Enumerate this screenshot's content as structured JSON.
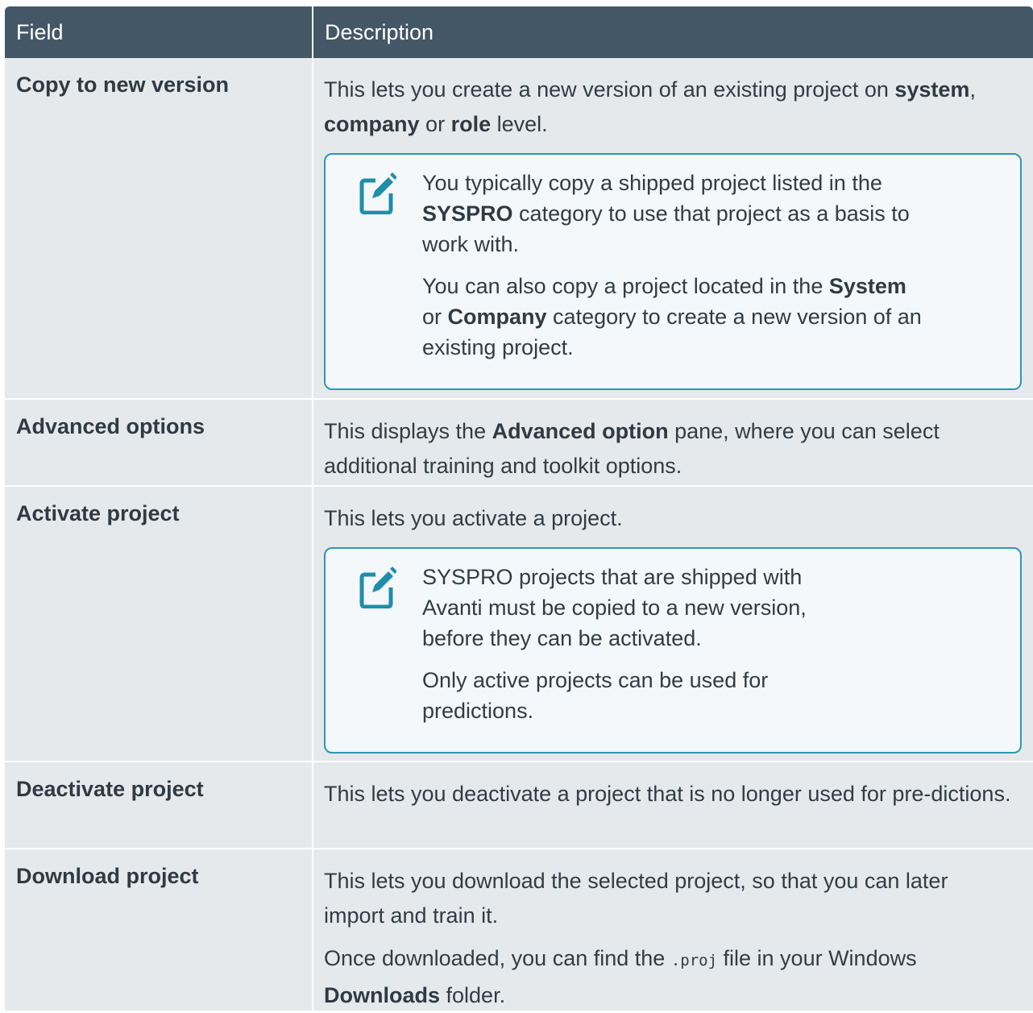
{
  "header": {
    "field": "Field",
    "description": "Description"
  },
  "rows": [
    {
      "field": "Copy to new version",
      "desc_parts": [
        "This lets you create a new version of an existing project on ",
        "system",
        ", ",
        "company",
        " or ",
        "role",
        " level."
      ],
      "note": {
        "p1_parts": [
          "You typically copy a shipped project listed in the ",
          "SYSPRO",
          " category to use that project as a basis to work with."
        ],
        "p2_parts": [
          "You can also copy a project located in the ",
          "System",
          " or ",
          "Company",
          " category to create a new version of an existing project."
        ]
      }
    },
    {
      "field": "Advanced options",
      "desc_parts": [
        "This displays the ",
        "Advanced option",
        " pane, where you can select additional training and toolkit options."
      ]
    },
    {
      "field": "Activate project",
      "desc": "This lets you activate a project.",
      "note": {
        "p1": "SYSPRO projects that are shipped with Avanti must be copied to a new version, before they can be activated.",
        "p2": "Only active projects can be used for predictions."
      }
    },
    {
      "field": "Deactivate project",
      "desc": "This lets you deactivate a project that is no longer used for pre-dictions."
    },
    {
      "field": "Download project",
      "desc": "This lets you download the selected project, so that you can later import and train it.",
      "desc2_parts": [
        "Once downloaded, you can find the ",
        ".proj",
        " file in your Windows ",
        "Downloads",
        " folder."
      ]
    }
  ],
  "icons": {
    "note_icon": "note-pencil-icon"
  },
  "colors": {
    "header_bg": "#435766",
    "row_bg": "#e6e9eb",
    "note_border": "#2b98b5",
    "note_bg": "#f4f8fa"
  }
}
